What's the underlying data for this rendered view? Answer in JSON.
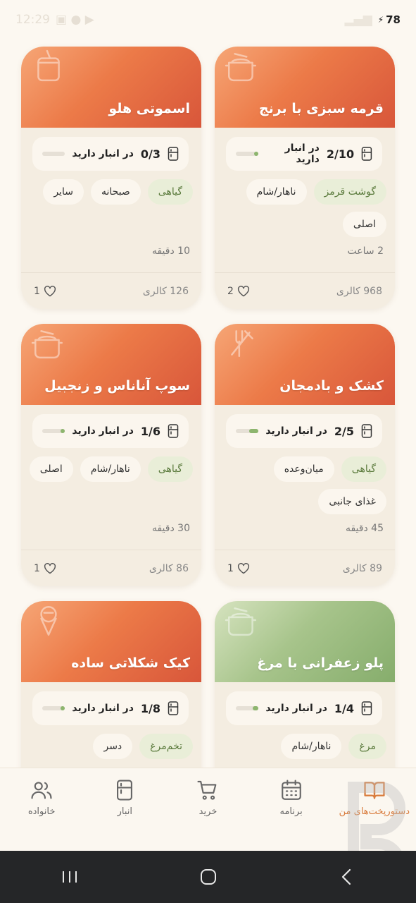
{
  "status_bar": {
    "time": "12:29",
    "battery": "78"
  },
  "colors": {
    "accent": "#d97b3c",
    "card_orange": "#e8703f",
    "card_green": "#9dbd81",
    "stock_green": "#8db56e"
  },
  "recipes": [
    {
      "title": "قرمه سبزی با برنج",
      "stock_count": "2/10",
      "stock_label": "در انبار دارید",
      "stock_fraction": 0.2,
      "tags": [
        "گوشت قرمز",
        "ناهار/شام",
        "اصلی"
      ],
      "green_tags": [
        true,
        false,
        false
      ],
      "time": "2 ساعت",
      "calories": "968 کالری",
      "likes": "2",
      "header_color": "orange",
      "header_icon": "pot-icon"
    },
    {
      "title": "اسموتی هلو",
      "stock_count": "0/3",
      "stock_label": "در انبار دارید",
      "stock_fraction": 0,
      "tags": [
        "گیاهی",
        "صبحانه",
        "سایر"
      ],
      "green_tags": [
        true,
        false,
        false
      ],
      "time": "10 دقیقه",
      "calories": "126 کالری",
      "likes": "1",
      "header_color": "orange",
      "header_icon": "cup-icon"
    },
    {
      "title": "کشک و بادمجان",
      "stock_count": "2/5",
      "stock_label": "در انبار دارید",
      "stock_fraction": 0.4,
      "tags": [
        "گیاهی",
        "میان‌وعده",
        "غذای جانبی"
      ],
      "green_tags": [
        true,
        false,
        false
      ],
      "time": "45 دقیقه",
      "calories": "89 کالری",
      "likes": "1",
      "header_color": "orange",
      "header_icon": "utensils-icon"
    },
    {
      "title": "سوپ آناناس و زنجبیل",
      "stock_count": "1/6",
      "stock_label": "در انبار دارید",
      "stock_fraction": 0.17,
      "tags": [
        "گیاهی",
        "ناهار/شام",
        "اصلی"
      ],
      "green_tags": [
        true,
        false,
        false
      ],
      "time": "30 دقیقه",
      "calories": "86 کالری",
      "likes": "1",
      "header_color": "orange",
      "header_icon": "pot-icon"
    },
    {
      "title": "پلو زعفرانی با مرغ",
      "stock_count": "1/4",
      "stock_label": "در انبار دارید",
      "stock_fraction": 0.25,
      "tags": [
        "مرغ",
        "ناهار/شام"
      ],
      "green_tags": [
        true,
        false
      ],
      "time": "",
      "calories": "",
      "likes": "",
      "header_color": "green",
      "header_icon": "pot-icon"
    },
    {
      "title": "کیک شکلاتی ساده",
      "stock_count": "1/8",
      "stock_label": "در انبار دارید",
      "stock_fraction": 0.12,
      "tags": [
        "تخم‌مرغ",
        "دسر"
      ],
      "green_tags": [
        true,
        false
      ],
      "time": "",
      "calories": "",
      "likes": "",
      "header_color": "orange",
      "header_icon": "ice-cream-icon"
    }
  ],
  "nav": {
    "items": [
      {
        "label": "دستورپخت‌های من",
        "icon": "book-icon",
        "active": true
      },
      {
        "label": "برنامه",
        "icon": "calendar-icon",
        "active": false
      },
      {
        "label": "خرید",
        "icon": "cart-icon",
        "active": false
      },
      {
        "label": "انبار",
        "icon": "fridge-icon",
        "active": false
      },
      {
        "label": "خانواده",
        "icon": "users-icon",
        "active": false
      }
    ]
  }
}
